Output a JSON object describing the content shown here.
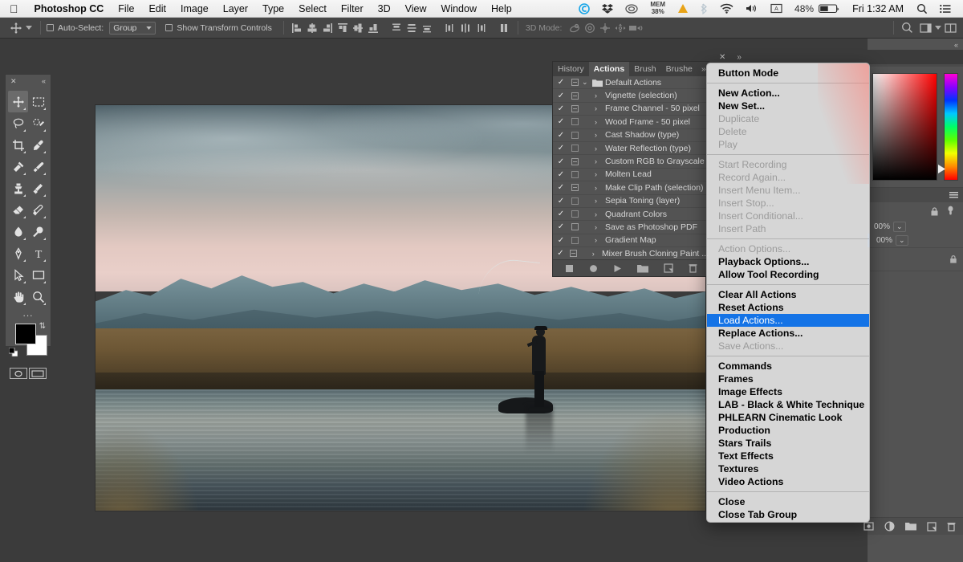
{
  "menubar": {
    "apple_icon": "apple-icon",
    "app_name": "Photoshop CC",
    "items": [
      "File",
      "Edit",
      "Image",
      "Layer",
      "Type",
      "Select",
      "Filter",
      "3D",
      "View",
      "Window",
      "Help"
    ],
    "status": {
      "memory_label": "MEM",
      "memory_value": "38%",
      "battery_percent": "48%",
      "clock": "Fri 1:32 AM",
      "icons": [
        "skype-icon",
        "dropbox-icon",
        "creative-cloud-icon",
        "memory-icon",
        "warning-icon",
        "bluetooth-icon",
        "wifi-icon",
        "volume-icon",
        "input-source-icon",
        "battery-icon",
        "spotlight-search-icon",
        "notification-center-icon"
      ]
    }
  },
  "options_bar": {
    "tool_icon": "move-tool-icon",
    "auto_select_label": "Auto-Select:",
    "auto_select_value": "Group",
    "show_transform_label": "Show Transform Controls",
    "three_d_mode_label": "3D Mode:",
    "align_icons": [
      "align-left-edges-icon",
      "align-horizontal-centers-icon",
      "align-right-edges-icon",
      "align-top-edges-icon",
      "align-vertical-centers-icon",
      "align-bottom-edges-icon"
    ],
    "distribute_icons": [
      "distribute-top-edges-icon",
      "distribute-vertical-centers-icon",
      "distribute-bottom-edges-icon",
      "distribute-left-edges-icon",
      "distribute-horizontal-centers-icon",
      "distribute-right-edges-icon"
    ],
    "three_d_icons": [
      "3d-orbit-icon",
      "3d-roll-icon",
      "3d-pan-icon",
      "3d-slide-icon",
      "3d-camera-icon"
    ]
  },
  "tools": {
    "close_icon": "close-icon",
    "collapse_icon": "collapse-panel-icon",
    "items": [
      {
        "name": "move-tool",
        "active": true
      },
      {
        "name": "rectangular-marquee-tool",
        "active": false
      },
      {
        "name": "lasso-tool",
        "active": false
      },
      {
        "name": "quick-selection-tool",
        "active": false
      },
      {
        "name": "crop-tool",
        "active": false
      },
      {
        "name": "eyedropper-tool",
        "active": false
      },
      {
        "name": "spot-healing-brush-tool",
        "active": false
      },
      {
        "name": "brush-tool",
        "active": false
      },
      {
        "name": "clone-stamp-tool",
        "active": false
      },
      {
        "name": "history-brush-tool",
        "active": false
      },
      {
        "name": "eraser-tool",
        "active": false
      },
      {
        "name": "gradient-tool",
        "active": false
      },
      {
        "name": "blur-tool",
        "active": false
      },
      {
        "name": "dodge-tool",
        "active": false
      },
      {
        "name": "pen-tool",
        "active": false
      },
      {
        "name": "type-tool",
        "active": false
      },
      {
        "name": "path-selection-tool",
        "active": false
      },
      {
        "name": "rectangle-tool",
        "active": false
      },
      {
        "name": "hand-tool",
        "active": false
      },
      {
        "name": "zoom-tool",
        "active": false
      }
    ],
    "more_tools": "...",
    "foreground_color": "#000000",
    "background_color": "#ffffff",
    "quick_mask_icon": "quick-mask-icon",
    "screen_mode_icon": "screen-mode-icon"
  },
  "actions_panel": {
    "tabs": [
      {
        "label": "History",
        "active": false
      },
      {
        "label": "Actions",
        "active": true
      },
      {
        "label": "Brush",
        "active": false
      },
      {
        "label": "Brushe",
        "active": false
      }
    ],
    "overflow_label": "»",
    "set_name": "Default Actions",
    "rows": [
      {
        "label": "Default Actions",
        "checked": true,
        "box": "dash",
        "folder": true,
        "twisty": "⌄"
      },
      {
        "label": "Vignette (selection)",
        "checked": true,
        "box": "dash",
        "folder": false,
        "twisty": "›"
      },
      {
        "label": "Frame Channel - 50 pixel",
        "checked": true,
        "box": "dash",
        "folder": false,
        "twisty": "›"
      },
      {
        "label": "Wood Frame - 50 pixel",
        "checked": true,
        "box": "blank",
        "folder": false,
        "twisty": "›"
      },
      {
        "label": "Cast Shadow (type)",
        "checked": true,
        "box": "blank",
        "folder": false,
        "twisty": "›"
      },
      {
        "label": "Water Reflection (type)",
        "checked": true,
        "box": "blank",
        "folder": false,
        "twisty": "›"
      },
      {
        "label": "Custom RGB to Grayscale",
        "checked": true,
        "box": "dash",
        "folder": false,
        "twisty": "›"
      },
      {
        "label": "Molten Lead",
        "checked": true,
        "box": "blank",
        "folder": false,
        "twisty": "›"
      },
      {
        "label": "Make Clip Path (selection)",
        "checked": true,
        "box": "dash",
        "folder": false,
        "twisty": "›"
      },
      {
        "label": "Sepia Toning (layer)",
        "checked": true,
        "box": "blank",
        "folder": false,
        "twisty": "›"
      },
      {
        "label": "Quadrant Colors",
        "checked": true,
        "box": "blank",
        "folder": false,
        "twisty": "›"
      },
      {
        "label": "Save as Photoshop PDF",
        "checked": true,
        "box": "empty",
        "folder": false,
        "twisty": "›"
      },
      {
        "label": "Gradient Map",
        "checked": true,
        "box": "blank",
        "folder": false,
        "twisty": "›"
      },
      {
        "label": "Mixer Brush Cloning Paint ...",
        "checked": true,
        "box": "dash",
        "folder": false,
        "twisty": "›"
      }
    ],
    "footer_icons": [
      "stop-recording-icon",
      "record-icon",
      "play-icon",
      "new-set-folder-icon",
      "new-action-icon",
      "delete-icon"
    ]
  },
  "context_menu": {
    "close_icon": "close-icon",
    "expand_icon": "expand-icon",
    "groups": [
      [
        {
          "label": "Button Mode",
          "state": "bold"
        }
      ],
      [
        {
          "label": "New Action...",
          "state": "bold"
        },
        {
          "label": "New Set...",
          "state": "bold"
        },
        {
          "label": "Duplicate",
          "state": "disabled"
        },
        {
          "label": "Delete",
          "state": "disabled"
        },
        {
          "label": "Play",
          "state": "disabled"
        }
      ],
      [
        {
          "label": "Start Recording",
          "state": "disabled"
        },
        {
          "label": "Record Again...",
          "state": "disabled"
        },
        {
          "label": "Insert Menu Item...",
          "state": "disabled"
        },
        {
          "label": "Insert Stop...",
          "state": "disabled"
        },
        {
          "label": "Insert Conditional...",
          "state": "disabled"
        },
        {
          "label": "Insert Path",
          "state": "disabled"
        }
      ],
      [
        {
          "label": "Action Options...",
          "state": "disabled"
        },
        {
          "label": "Playback Options...",
          "state": "bold"
        },
        {
          "label": "Allow Tool Recording",
          "state": "bold"
        }
      ],
      [
        {
          "label": "Clear All Actions",
          "state": "bold"
        },
        {
          "label": "Reset Actions",
          "state": "bold"
        },
        {
          "label": "Load Actions...",
          "state": "selected"
        },
        {
          "label": "Replace Actions...",
          "state": "bold"
        },
        {
          "label": "Save Actions...",
          "state": "disabled"
        }
      ],
      [
        {
          "label": "Commands",
          "state": "bold"
        },
        {
          "label": "Frames",
          "state": "bold"
        },
        {
          "label": "Image Effects",
          "state": "bold"
        },
        {
          "label": "LAB - Black & White Technique",
          "state": "bold"
        },
        {
          "label": "PHLEARN Cinematic Look",
          "state": "bold"
        },
        {
          "label": "Production",
          "state": "bold"
        },
        {
          "label": "Stars Trails",
          "state": "bold"
        },
        {
          "label": "Text Effects",
          "state": "bold"
        },
        {
          "label": "Textures",
          "state": "bold"
        },
        {
          "label": "Video Actions",
          "state": "bold"
        }
      ],
      [
        {
          "label": "Close",
          "state": "bold"
        },
        {
          "label": "Close Tab Group",
          "state": "bold"
        }
      ]
    ],
    "highlight_color": "#1473e6"
  },
  "right_dock": {
    "collapse_icon": "collapse-dock-icon",
    "color_panel": {
      "menu_icon": "panel-menu-icon",
      "hue_thumb": "hue-slider-thumb"
    },
    "layers_panel": {
      "menu_icon": "panel-menu-icon",
      "opacity_value": "00%",
      "fill_value": "00%",
      "lock_icon": "lock-icon",
      "visibility_icon": "eye-icon",
      "footer_icons": [
        "add-layer-mask-icon",
        "adjustment-layer-icon",
        "new-group-icon",
        "new-layer-icon",
        "delete-layer-icon"
      ]
    }
  },
  "document": {
    "name": "fisherman-landscape",
    "alt": "A fly fisherman casting on a riverbank with snow-capped mountains at dusk"
  }
}
